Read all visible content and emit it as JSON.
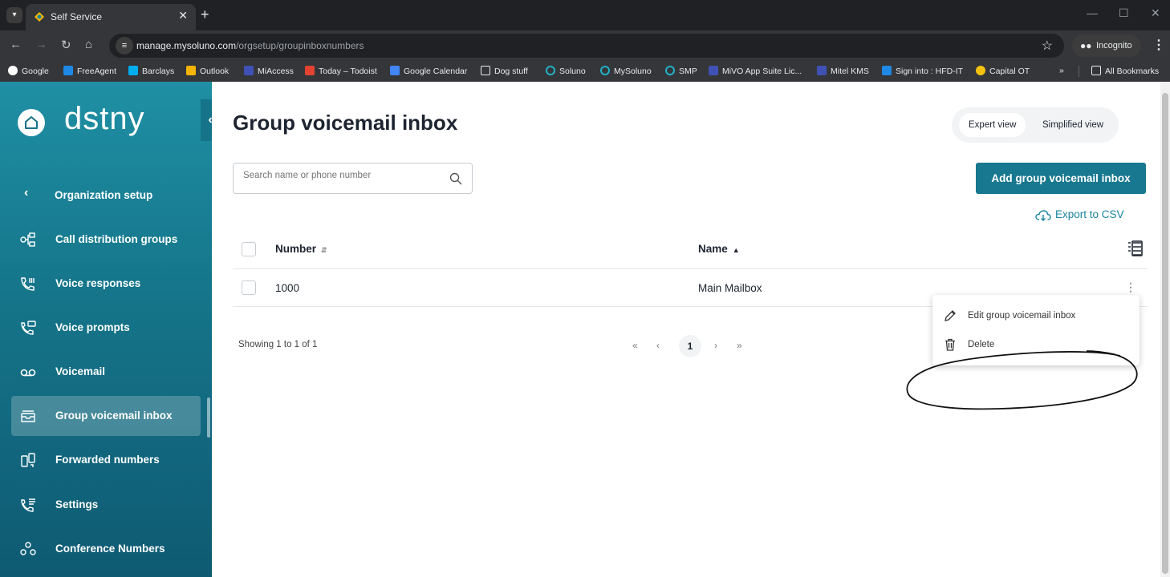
{
  "browser": {
    "tab_title": "Self Service",
    "url_host": "manage.mysoluno.com",
    "url_path": "/orgsetup/groupinboxnumbers",
    "incognito_label": "Incognito",
    "bookmarks": [
      {
        "label": "Google",
        "color": "#4285f4"
      },
      {
        "label": "FreeAgent",
        "color": "#1e88e5"
      },
      {
        "label": "Barclays",
        "color": "#00aeef"
      },
      {
        "label": "Outlook",
        "color": "#f4b400"
      },
      {
        "label": "MiAccess",
        "color": "#3f51b5"
      },
      {
        "label": "Today – Todoist",
        "color": "#e44332"
      },
      {
        "label": "Google Calendar",
        "color": "#4285f4"
      },
      {
        "label": "Dog stuff",
        "color": "#35363a"
      },
      {
        "label": "Soluno",
        "color": "#35363a"
      },
      {
        "label": "MySoluno",
        "color": "#35363a"
      },
      {
        "label": "SMP",
        "color": "#35363a"
      },
      {
        "label": "MiVO App Suite Lic...",
        "color": "#3f51b5"
      },
      {
        "label": "Mitel KMS",
        "color": "#3f51b5"
      },
      {
        "label": "Sign into : HFD-IT",
        "color": "#1e88e5"
      },
      {
        "label": "Capital OT",
        "color": "#f4c20d"
      }
    ],
    "overflow_label": "»",
    "all_bookmarks_label": "All Bookmarks"
  },
  "sidebar": {
    "logo_text": "dstny",
    "section_label": "Organization setup",
    "items": [
      {
        "label": "Call distribution groups",
        "icon": "call-distribution-icon"
      },
      {
        "label": "Voice responses",
        "icon": "voice-responses-icon"
      },
      {
        "label": "Voice prompts",
        "icon": "voice-prompts-icon"
      },
      {
        "label": "Voicemail",
        "icon": "voicemail-icon"
      },
      {
        "label": "Group voicemail inbox",
        "icon": "inbox-icon",
        "active": true
      },
      {
        "label": "Forwarded numbers",
        "icon": "forwarded-numbers-icon"
      },
      {
        "label": "Settings",
        "icon": "phone-settings-icon"
      },
      {
        "label": "Conference Numbers",
        "icon": "conference-icon"
      }
    ]
  },
  "main": {
    "title": "Group voicemail inbox",
    "view_toggle": {
      "expert": "Expert view",
      "simplified": "Simplified view",
      "selected": "expert"
    },
    "search_placeholder": "Search name or phone number",
    "add_button": "Add group voicemail inbox",
    "export_label": "Export to CSV",
    "table": {
      "columns": {
        "number": "Number",
        "name": "Name"
      },
      "rows": [
        {
          "number": "1000",
          "name": "Main Mailbox"
        }
      ]
    },
    "showing_text": "Showing 1 to 1 of 1",
    "pagination": {
      "first": "«",
      "prev": "‹",
      "current": "1",
      "next": "›",
      "last": "»"
    },
    "context_menu": {
      "edit": "Edit group voicemail inbox",
      "delete": "Delete"
    }
  },
  "colors": {
    "accent": "#18788f",
    "sidebar": "#157489",
    "link": "#1a85a0"
  }
}
